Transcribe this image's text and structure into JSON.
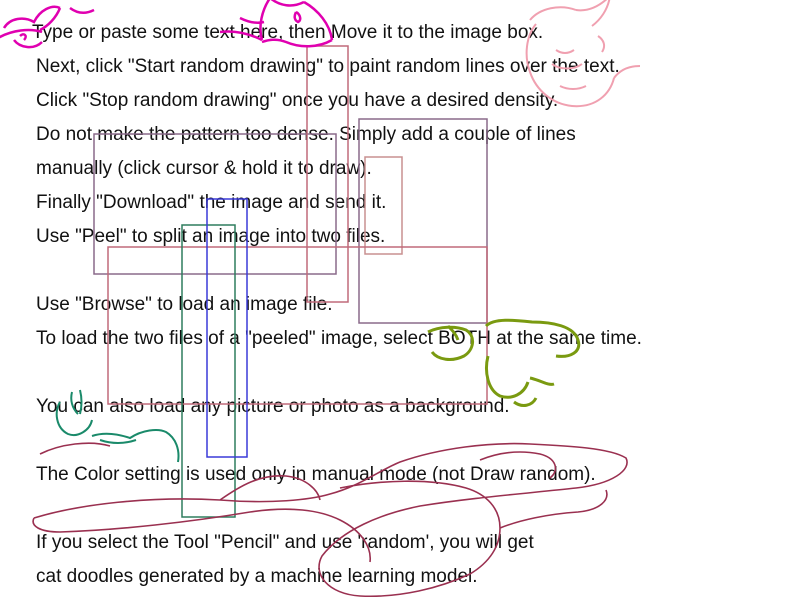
{
  "canvas_text": {
    "lines": [
      "Type or paste some text here, then Move it to the image box.",
      "Next, click \"Start random drawing\" to paint random lines over the text.",
      "Click \"Stop random drawing\" once you have a desired density.",
      "Do not make the pattern too dense. Simply add a couple of lines",
      "manually (click cursor & hold it to draw).",
      "Finally \"Download\" the image and send it.",
      "Use \"Peel\" to split an image into two files.",
      "Use \"Browse\" to load an image file.",
      "To load the two files of a \"peeled\" image, select BOTH at the same time.",
      "You can also load any picture or photo as a background.",
      "The Color setting is used only in manual mode (not Draw random).",
      "If you select the Tool \"Pencil\" and use 'random', you will get",
      "cat doodles generated by a machine learning model."
    ]
  },
  "colors": {
    "text": "#111111",
    "rect_purple": "#8a6a8a",
    "rect_rose": "#c06a7a",
    "rect_green": "#2e7d5e",
    "rect_blue": "#3a3ad8",
    "rect_pink": "#c89090",
    "scribble_maroon": "#9a3050",
    "cat_magenta": "#e000b0",
    "cat_pink": "#f0a0b0",
    "cat_olive": "#7a9a10",
    "cat_teal": "#1a8a6a"
  }
}
